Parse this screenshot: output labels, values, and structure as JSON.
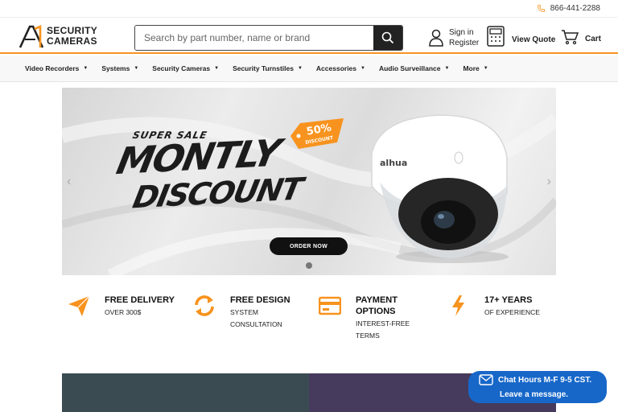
{
  "topbar": {
    "phone": "866-441-2288"
  },
  "header": {
    "logo_line1": "SECURITY",
    "logo_line2": "CAMERAS",
    "search_placeholder": "Search by part number, name or brand",
    "signin_line1": "Sign in",
    "signin_line2": "Register",
    "view_quote": "View Quote",
    "cart": "Cart"
  },
  "nav": {
    "items": [
      {
        "label": "Video Recorders"
      },
      {
        "label": "Systems"
      },
      {
        "label": "Security Cameras"
      },
      {
        "label": "Security Turnstiles"
      },
      {
        "label": "Accessories"
      },
      {
        "label": "Audio Surveillance"
      },
      {
        "label": "More"
      }
    ]
  },
  "hero": {
    "super": "SUPER SALE",
    "title1": "MONTLY",
    "title2": "DISCOUNT",
    "badge_pct": "50%",
    "badge_text": "DISCOUNT",
    "cam_brand": "alhua",
    "cta": "ORDER NOW"
  },
  "features": [
    {
      "title": "FREE DELIVERY",
      "sub1": "OVER 300$",
      "sub2": ""
    },
    {
      "title": "FREE DESIGN",
      "sub1": "SYSTEM",
      "sub2": "CONSULTATION"
    },
    {
      "title": "PAYMENT",
      "title2": "OPTIONS",
      "sub1": "INTEREST-FREE",
      "sub2": "TERMS"
    },
    {
      "title": "17+ YEARS",
      "sub1": "OF EXPERIENCE",
      "sub2": ""
    }
  ],
  "chat": {
    "line1": "Chat Hours M-F 9-5 CST.",
    "line2": "Leave a message."
  },
  "colors": {
    "accent": "#f7931e",
    "chat": "#1767c9",
    "dark": "#222222"
  }
}
